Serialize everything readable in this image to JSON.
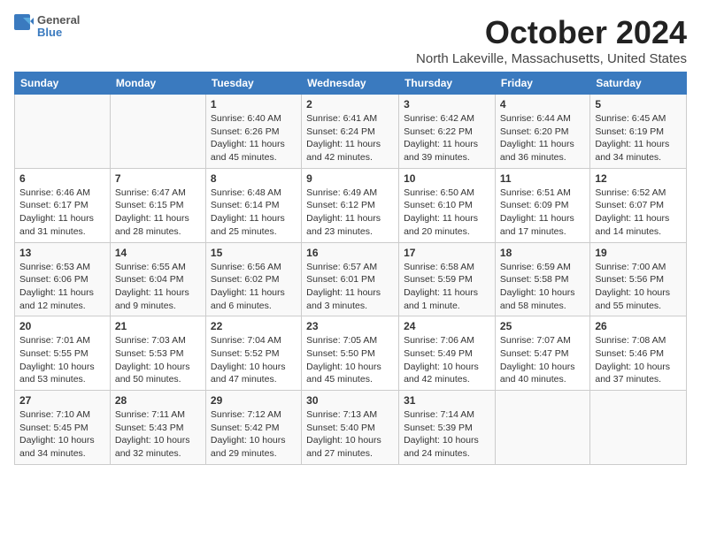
{
  "header": {
    "logo_line1": "General",
    "logo_line2": "Blue",
    "month": "October 2024",
    "location": "North Lakeville, Massachusetts, United States"
  },
  "days_of_week": [
    "Sunday",
    "Monday",
    "Tuesday",
    "Wednesday",
    "Thursday",
    "Friday",
    "Saturday"
  ],
  "weeks": [
    [
      {
        "day": "",
        "info": ""
      },
      {
        "day": "",
        "info": ""
      },
      {
        "day": "1",
        "info": "Sunrise: 6:40 AM\nSunset: 6:26 PM\nDaylight: 11 hours and 45 minutes."
      },
      {
        "day": "2",
        "info": "Sunrise: 6:41 AM\nSunset: 6:24 PM\nDaylight: 11 hours and 42 minutes."
      },
      {
        "day": "3",
        "info": "Sunrise: 6:42 AM\nSunset: 6:22 PM\nDaylight: 11 hours and 39 minutes."
      },
      {
        "day": "4",
        "info": "Sunrise: 6:44 AM\nSunset: 6:20 PM\nDaylight: 11 hours and 36 minutes."
      },
      {
        "day": "5",
        "info": "Sunrise: 6:45 AM\nSunset: 6:19 PM\nDaylight: 11 hours and 34 minutes."
      }
    ],
    [
      {
        "day": "6",
        "info": "Sunrise: 6:46 AM\nSunset: 6:17 PM\nDaylight: 11 hours and 31 minutes."
      },
      {
        "day": "7",
        "info": "Sunrise: 6:47 AM\nSunset: 6:15 PM\nDaylight: 11 hours and 28 minutes."
      },
      {
        "day": "8",
        "info": "Sunrise: 6:48 AM\nSunset: 6:14 PM\nDaylight: 11 hours and 25 minutes."
      },
      {
        "day": "9",
        "info": "Sunrise: 6:49 AM\nSunset: 6:12 PM\nDaylight: 11 hours and 23 minutes."
      },
      {
        "day": "10",
        "info": "Sunrise: 6:50 AM\nSunset: 6:10 PM\nDaylight: 11 hours and 20 minutes."
      },
      {
        "day": "11",
        "info": "Sunrise: 6:51 AM\nSunset: 6:09 PM\nDaylight: 11 hours and 17 minutes."
      },
      {
        "day": "12",
        "info": "Sunrise: 6:52 AM\nSunset: 6:07 PM\nDaylight: 11 hours and 14 minutes."
      }
    ],
    [
      {
        "day": "13",
        "info": "Sunrise: 6:53 AM\nSunset: 6:06 PM\nDaylight: 11 hours and 12 minutes."
      },
      {
        "day": "14",
        "info": "Sunrise: 6:55 AM\nSunset: 6:04 PM\nDaylight: 11 hours and 9 minutes."
      },
      {
        "day": "15",
        "info": "Sunrise: 6:56 AM\nSunset: 6:02 PM\nDaylight: 11 hours and 6 minutes."
      },
      {
        "day": "16",
        "info": "Sunrise: 6:57 AM\nSunset: 6:01 PM\nDaylight: 11 hours and 3 minutes."
      },
      {
        "day": "17",
        "info": "Sunrise: 6:58 AM\nSunset: 5:59 PM\nDaylight: 11 hours and 1 minute."
      },
      {
        "day": "18",
        "info": "Sunrise: 6:59 AM\nSunset: 5:58 PM\nDaylight: 10 hours and 58 minutes."
      },
      {
        "day": "19",
        "info": "Sunrise: 7:00 AM\nSunset: 5:56 PM\nDaylight: 10 hours and 55 minutes."
      }
    ],
    [
      {
        "day": "20",
        "info": "Sunrise: 7:01 AM\nSunset: 5:55 PM\nDaylight: 10 hours and 53 minutes."
      },
      {
        "day": "21",
        "info": "Sunrise: 7:03 AM\nSunset: 5:53 PM\nDaylight: 10 hours and 50 minutes."
      },
      {
        "day": "22",
        "info": "Sunrise: 7:04 AM\nSunset: 5:52 PM\nDaylight: 10 hours and 47 minutes."
      },
      {
        "day": "23",
        "info": "Sunrise: 7:05 AM\nSunset: 5:50 PM\nDaylight: 10 hours and 45 minutes."
      },
      {
        "day": "24",
        "info": "Sunrise: 7:06 AM\nSunset: 5:49 PM\nDaylight: 10 hours and 42 minutes."
      },
      {
        "day": "25",
        "info": "Sunrise: 7:07 AM\nSunset: 5:47 PM\nDaylight: 10 hours and 40 minutes."
      },
      {
        "day": "26",
        "info": "Sunrise: 7:08 AM\nSunset: 5:46 PM\nDaylight: 10 hours and 37 minutes."
      }
    ],
    [
      {
        "day": "27",
        "info": "Sunrise: 7:10 AM\nSunset: 5:45 PM\nDaylight: 10 hours and 34 minutes."
      },
      {
        "day": "28",
        "info": "Sunrise: 7:11 AM\nSunset: 5:43 PM\nDaylight: 10 hours and 32 minutes."
      },
      {
        "day": "29",
        "info": "Sunrise: 7:12 AM\nSunset: 5:42 PM\nDaylight: 10 hours and 29 minutes."
      },
      {
        "day": "30",
        "info": "Sunrise: 7:13 AM\nSunset: 5:40 PM\nDaylight: 10 hours and 27 minutes."
      },
      {
        "day": "31",
        "info": "Sunrise: 7:14 AM\nSunset: 5:39 PM\nDaylight: 10 hours and 24 minutes."
      },
      {
        "day": "",
        "info": ""
      },
      {
        "day": "",
        "info": ""
      }
    ]
  ]
}
